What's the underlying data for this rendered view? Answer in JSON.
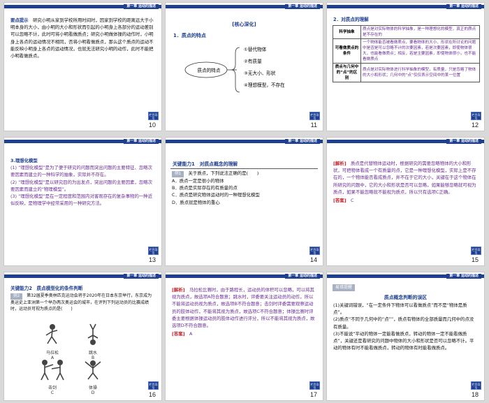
{
  "tag": "第一章 运动的描述",
  "nav": "栏目导引",
  "s10": {
    "num": "10",
    "hint_label": "要点提示",
    "hint_text": "研究小明从家到学校所用时间时，因家到学校的距离远大于小明本身的大小，由小明的大小和形状而引起的小明身上各部分的运动差别可以忽略不计，此时可将小明看做质点；研究小明做体操的动作时，小明身上各点的运动情况不相同，否将小明看做质点，那么这个质点的运动不能反映小明身上各点的运动情况，也就无法研究小明的动作，此时不能把小明看做质点。"
  },
  "s11": {
    "num": "11",
    "header": "[核心深化]",
    "title": "1．质点的特点",
    "center": "质点的特点",
    "items": [
      "①替代物体",
      "②有质量",
      "③无大小、形状",
      "④理想模型，不存在"
    ]
  },
  "s12": {
    "num": "12",
    "title": "2．对质点的理解",
    "rows": [
      {
        "k": "科学抽象",
        "v": "质点是对实际物体的科学抽象，是一种理想化的模型，真正的质点是不存在的"
      },
      {
        "k": "可看做质点的条件",
        "v": "一个物体能否被看做质点，要看物体的大小、形状在所讨论的问题中是否是可以忽略不计的次要因素，若是次要因素，即使物体很大，也能看做质点；相反，若是主要因素，即使物体很小，也不能看做质点"
      },
      {
        "k": "质点与几何中的“点”的区别",
        "v": "质点是对实际物体进行科学抽象的模型，有质量，只是忽略了物体的大小和形状；几何中的“点”仅仅表示空间中的某一位置"
      }
    ]
  },
  "s13": {
    "num": "13",
    "title": "3.理想化模型",
    "p1": "(1) “理想化模型”是为了便于研究的问题而突出问题的主要特征、忽略次要因素而建立的一种科学的抽象，实际并不存在。",
    "p2": "(2) “理想化模型”是以研究目的为出发点，突出问题的主要因素，忽略次要因素而建立的“物理模型”。",
    "p3": "(3) “理想化模型”是在一定程度和范围内对客观存在的复杂事物的一种近似反映，是物理学中经常采用的一种研究方法。"
  },
  "s14": {
    "num": "14",
    "title": "关键能力1　对质点概念的理解",
    "example_label": "例1",
    "stem": "关于质点，下列说法正确的是(　　)",
    "options": [
      "A．质点一定是很小的物体",
      "B．质点是实际存在的有质量的点",
      "C．质点是研究物体运动时的一种理想化模型",
      "D．质点就是物体的重心"
    ]
  },
  "s15": {
    "num": "15",
    "label": "[解析]",
    "text": "质点是代替物体运动时，根据研究的需要忽略物体的大小和形状，可把物体看成一个有质量的点，它是一种理想化模型，实际上是不存在的，一个物体能否看成质点，并不在于它的大小，关键在于这个物体在所研究的问题中，它的大小和形状是否可以忽略，如果能够忽略就可视为质点，如果不能忽略就不能视为质点，所以只有选项C正确。",
    "answer_label": "[答案]",
    "answer": "C"
  },
  "s16": {
    "num": "16",
    "title": "关键能力2　质点模型化的条件判断",
    "example_label": "例2",
    "stem": "第32届夏季奥林匹克运动会将于2020年在日本东京举行，东京成为奥运史上亚洲第一个举办两次奥运会的城市，在评判下列运动员的比赛成绩时，运动员可视为质点的是(　　)",
    "figs": [
      "马拉松",
      "跳水",
      "击剑",
      "体操"
    ],
    "fig_letters": [
      "A",
      "B",
      "C",
      "D"
    ]
  },
  "s17": {
    "num": "17",
    "label": "[解析]",
    "text": "马拉松比赛时，由于路程长，运动员的体积可以忽略，可以将其视为质点，故选项A符合题意；跳水时，评委要关注运动员的动作，所以不能将运动员视为质点，故选项B不符合题意；击剑时评委需要观察运动员的肢体动作，不能将其视为质点，故选项C不符合题意；体操比赛时评委主要根据体操运动员的肢体动作进行评分，所以不能将其视为质点，故选项D不符合题意。",
    "answer_label": "[答案]",
    "answer": "A"
  },
  "s18": {
    "num": "18",
    "header": "易错提醒",
    "title": "质点概念判断的误区",
    "p1": "(1)关键词错误，“在一定条件下物体可以看做质点”而不是“物体是质点”。",
    "p2": "(2)质点“不同于几何中的“点””，质点有物体的全部质量而几何中的点没有质量。",
    "p3": "(3)不能说“平动的物体一定能看做质点，转动的物体一定不能看做质点”，关键还是看研究的问题中物体的大小和形状是否可以忽略不计。平动的物体有时不能看做质点，转动的物体有时能看做质点。"
  }
}
